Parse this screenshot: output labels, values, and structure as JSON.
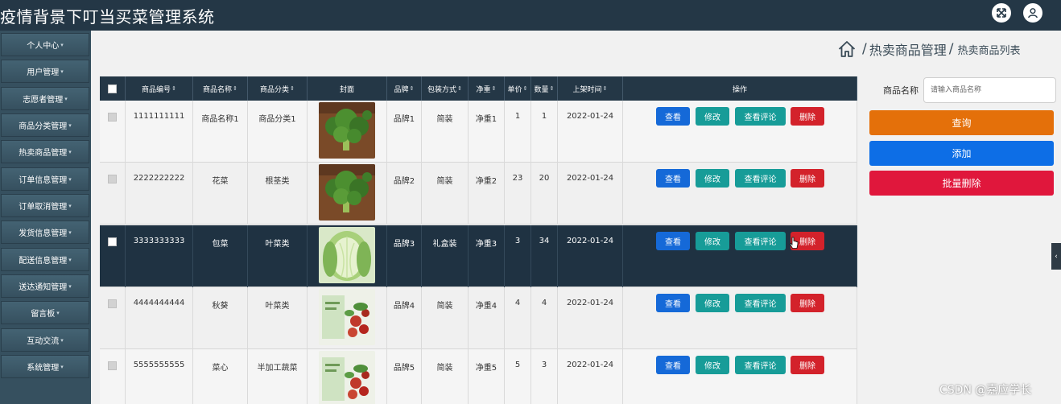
{
  "app": {
    "title": "疫情背景下叮当买菜管理系统"
  },
  "header": {
    "fullscreen_icon": "fullscreen-icon",
    "user_icon": "user-icon"
  },
  "sidebar": {
    "items": [
      {
        "label": "个人中心"
      },
      {
        "label": "用户管理"
      },
      {
        "label": "志愿者管理"
      },
      {
        "label": "商品分类管理"
      },
      {
        "label": "热卖商品管理"
      },
      {
        "label": "订单信息管理"
      },
      {
        "label": "订单取消管理"
      },
      {
        "label": "发货信息管理"
      },
      {
        "label": "配送信息管理"
      },
      {
        "label": "送达通知管理"
      },
      {
        "label": "留言板"
      },
      {
        "label": "互动交流"
      },
      {
        "label": "系统管理"
      }
    ]
  },
  "breadcrumb": {
    "section": "热卖商品管理",
    "page": "热卖商品列表",
    "separator": "/"
  },
  "table": {
    "sort_indicator": "⇕",
    "columns": [
      "",
      "商品编号",
      "商品名称",
      "商品分类",
      "封面",
      "品牌",
      "包装方式",
      "净重",
      "单价",
      "数量",
      "上架时间",
      "操作"
    ],
    "sortable": [
      false,
      true,
      true,
      true,
      false,
      true,
      true,
      true,
      true,
      true,
      true,
      false
    ],
    "actions": {
      "view": "查看",
      "edit": "修改",
      "comments": "查看评论",
      "delete": "删除"
    },
    "rows": [
      {
        "id": "1111111111",
        "name": "商品名称1",
        "category": "商品分类1",
        "cover": "broccoli",
        "brand": "品牌1",
        "packaging": "简装",
        "weight": "净重1",
        "price": "1",
        "quantity": "1",
        "date": "2022-01-24"
      },
      {
        "id": "2222222222",
        "name": "花菜",
        "category": "根茎类",
        "cover": "broccoli",
        "brand": "品牌2",
        "packaging": "简装",
        "weight": "净重2",
        "price": "23",
        "quantity": "20",
        "date": "2022-01-24"
      },
      {
        "id": "3333333333",
        "name": "包菜",
        "category": "叶菜类",
        "cover": "cabbage",
        "brand": "品牌3",
        "packaging": "礼盒装",
        "weight": "净重3",
        "price": "3",
        "quantity": "34",
        "date": "2022-01-24"
      },
      {
        "id": "4444444444",
        "name": "秋葵",
        "category": "叶菜类",
        "cover": "produce",
        "brand": "品牌4",
        "packaging": "简装",
        "weight": "净重4",
        "price": "4",
        "quantity": "4",
        "date": "2022-01-24"
      },
      {
        "id": "5555555555",
        "name": "菜心",
        "category": "半加工蔬菜",
        "cover": "produce",
        "brand": "品牌5",
        "packaging": "简装",
        "weight": "净重5",
        "price": "5",
        "quantity": "3",
        "date": "2022-01-24"
      }
    ]
  },
  "search": {
    "label": "商品名称",
    "placeholder": "请输入商品名称",
    "value": ""
  },
  "buttons": {
    "query": "查询",
    "add": "添加",
    "batch_delete": "批量删除"
  },
  "watermark": "CSDN @嘉应学长",
  "colors": {
    "header": "#243746",
    "sidebar": "#36505f",
    "view": "#1569d8",
    "edit": "#179c98",
    "delete": "#d3222b",
    "query": "#e4700a",
    "add": "#0d6ee6",
    "batch_delete": "#e0173c"
  }
}
